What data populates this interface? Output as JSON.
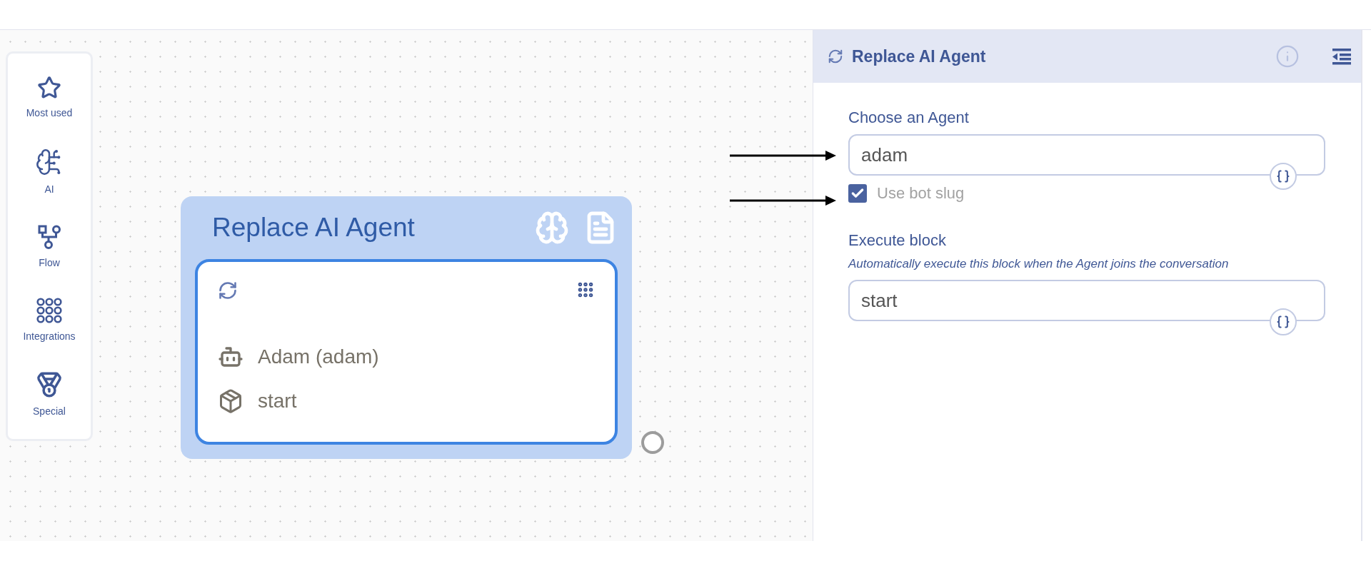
{
  "palette": [
    {
      "kind": "star",
      "label": "Most used"
    },
    {
      "kind": "ai",
      "label": "AI"
    },
    {
      "kind": "flow",
      "label": "Flow"
    },
    {
      "kind": "integrations",
      "label": "Integrations"
    },
    {
      "kind": "special",
      "label": "Special"
    }
  ],
  "node": {
    "title": "Replace AI Agent",
    "agent": "Adam (adam)",
    "block": "start"
  },
  "panel": {
    "title": "Replace AI Agent",
    "agent_field": {
      "label": "Choose an Agent",
      "value": "adam"
    },
    "checkbox": {
      "label": "Use bot slug",
      "checked": true
    },
    "block_field": {
      "label": "Execute block",
      "hint": "Automatically execute this block when the Agent joins the conversation",
      "value": "start"
    }
  }
}
